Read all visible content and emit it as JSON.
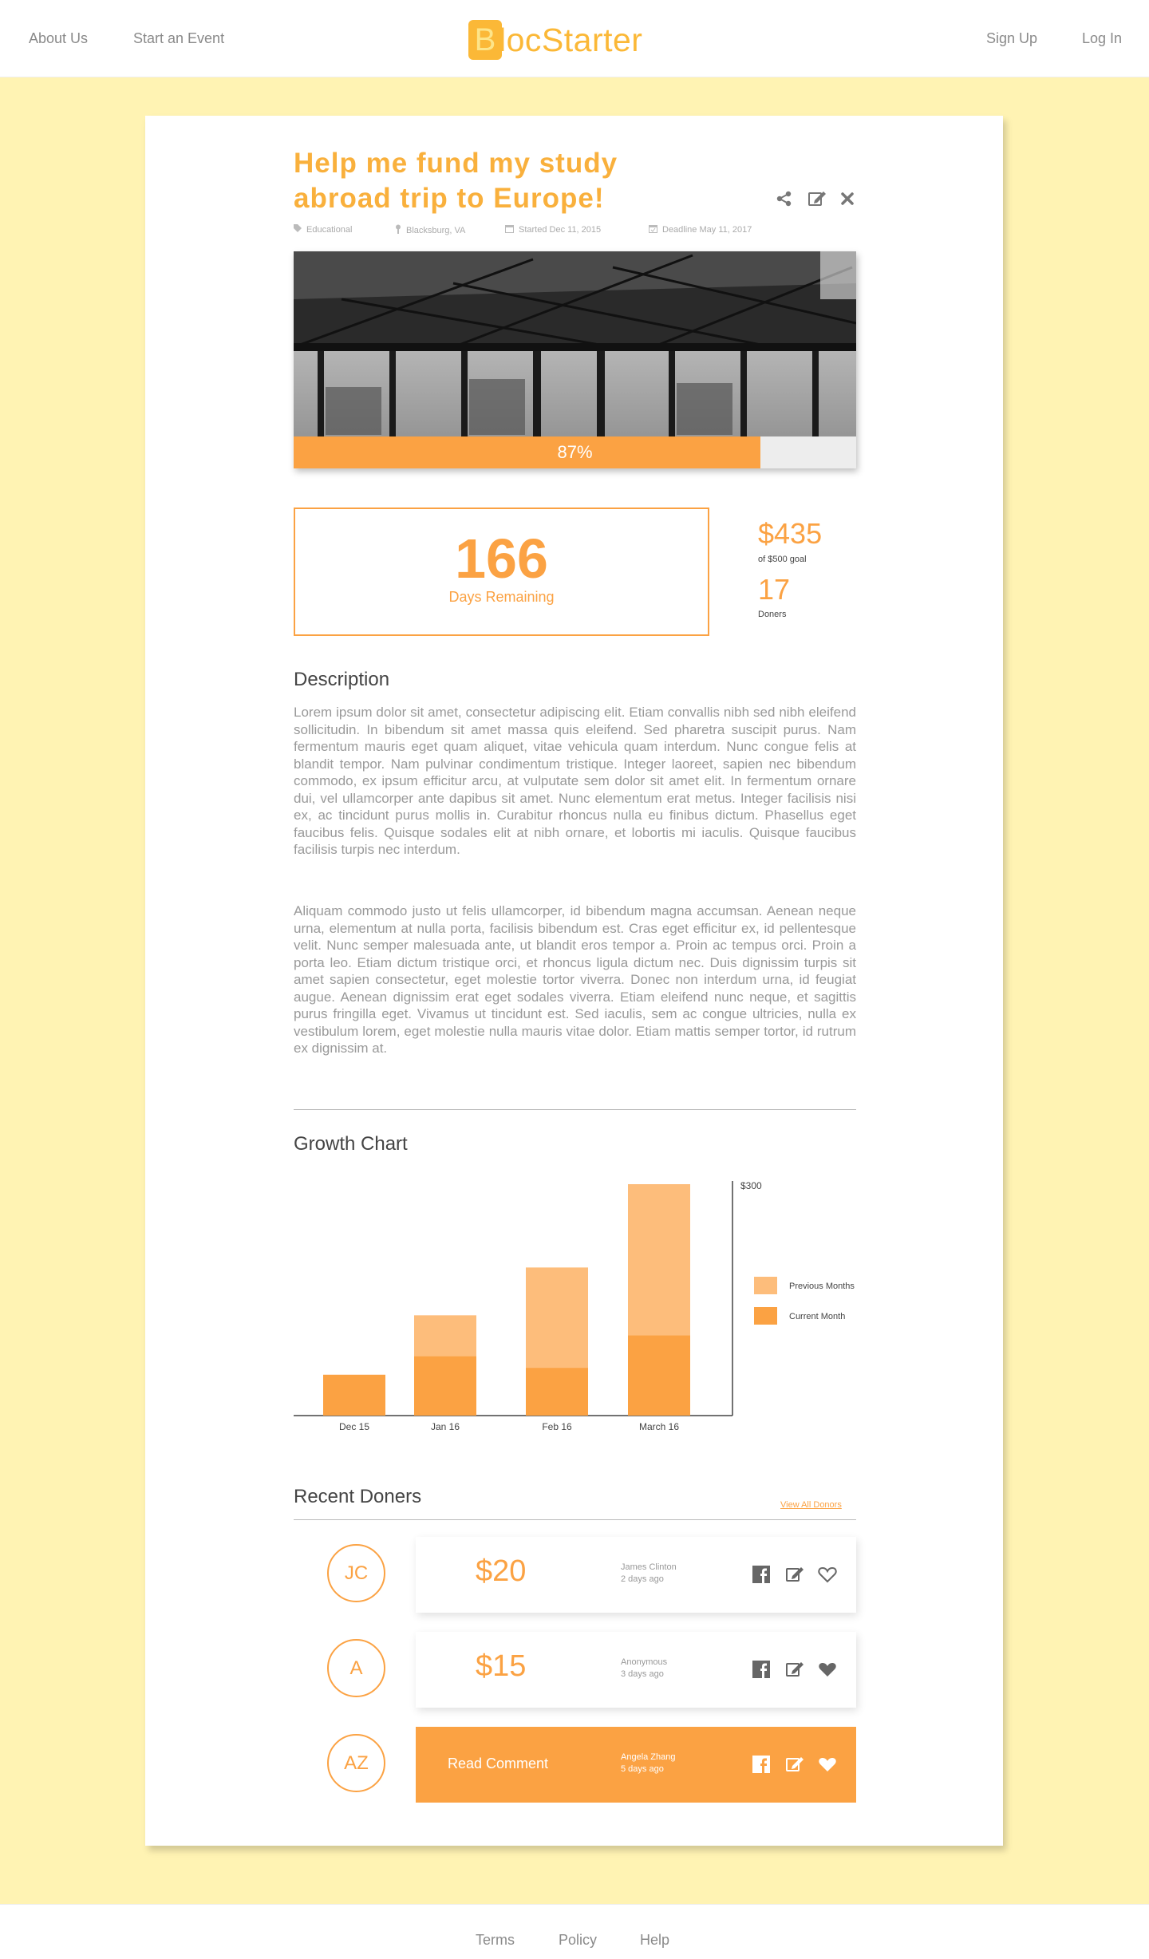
{
  "nav": {
    "about": "About Us",
    "start_event": "Start an Event",
    "logo_letter": "B",
    "logo_rest": "locStarter",
    "sign_up": "Sign Up",
    "log_in": "Log In"
  },
  "campaign": {
    "title": "Help me fund my study abroad trip to Europe!",
    "category": "Educational",
    "location": "Blacksburg, VA",
    "started": "Started Dec 11, 2015",
    "deadline": "Deadline May 11, 2017",
    "progress_label": "87%",
    "progress_fraction": 0.83,
    "days_remaining": "166",
    "days_label": "Days Remaining",
    "raised": "$435",
    "goal": "of $500 goal",
    "doners_count": "17",
    "doners_label": "Doners"
  },
  "description": {
    "heading": "Description",
    "p1": "Lorem ipsum dolor sit amet, consectetur adipiscing elit. Etiam convallis nibh sed nibh eleifend sollicitudin. In bibendum sit amet massa quis eleifend. Sed pharetra suscipit purus. Nam fermentum mauris eget quam aliquet, vitae vehicula quam interdum. Nunc congue felis at blandit tempor. Nam pulvinar condimentum tristique. Integer laoreet, sapien nec bibendum commodo, ex ipsum efficitur arcu, at vulputate sem dolor sit amet elit. In fermentum ornare dui, vel ullamcorper ante dapibus sit amet. Nunc elementum erat metus. Integer facilisis nisi ex, ac tincidunt purus mollis in. Curabitur rhoncus nulla eu finibus dictum. Phasellus eget faucibus felis. Quisque sodales elit at nibh ornare, et lobortis mi iaculis. Quisque faucibus facilisis turpis nec interdum.",
    "p2": "Aliquam commodo justo ut felis ullamcorper, id bibendum magna accumsan. Aenean neque urna, elementum at nulla porta, facilisis bibendum est. Cras eget efficitur ex, id pellentesque velit. Nunc semper malesuada ante, ut blandit eros tempor a. Proin ac tempus orci. Proin a porta leo. Etiam dictum tristique orci, et rhoncus ligula dictum nec. Duis dignissim turpis sit amet sapien consectetur, eget molestie tortor viverra. Donec non interdum urna, id feugiat augue. Aenean dignissim erat eget sodales viverra. Etiam eleifend nunc neque, et sagittis purus fringilla eget. Vivamus ut tincidunt est. Sed iaculis, sem ac congue ultricies, nulla ex vestibulum lorem, eget molestie nulla mauris vitae dolor. Etiam mattis semper tortor, id rutrum ex dignissim at."
  },
  "chart_heading": "Growth Chart",
  "chart_data": {
    "type": "bar",
    "stacked": true,
    "categories": [
      "Dec 15",
      "Jan 16",
      "Feb 16",
      "March 16"
    ],
    "series": [
      {
        "name": "Current Month",
        "values": [
          53,
          77,
          62,
          104
        ],
        "color": "#fba243"
      },
      {
        "name": "Previous Months",
        "values": [
          0,
          53,
          130,
          196
        ],
        "color": "#fdbd7b"
      }
    ],
    "ylim": [
      0,
      300
    ],
    "y_tick_label": "$300",
    "legend": "right"
  },
  "doners": {
    "heading": "Recent Doners",
    "view_all": "View All Donors",
    "items": [
      {
        "initials": "JC",
        "amount": "$20",
        "name": "James Clinton",
        "time": "2 days ago",
        "liked": false
      },
      {
        "initials": "A",
        "amount": "$15",
        "name": "Anonymous",
        "time": "3 days ago",
        "liked": true
      },
      {
        "initials": "AZ",
        "amount": "Read Comment",
        "name": "Angela Zhang",
        "time": "5 days ago",
        "liked": true
      }
    ]
  },
  "footer": {
    "terms": "Terms",
    "policy": "Policy",
    "help": "Help"
  },
  "colors": {
    "accent": "#fba243",
    "title": "#f9b03c",
    "background": "#fff3b3",
    "light_accent": "#fdbd7b"
  }
}
